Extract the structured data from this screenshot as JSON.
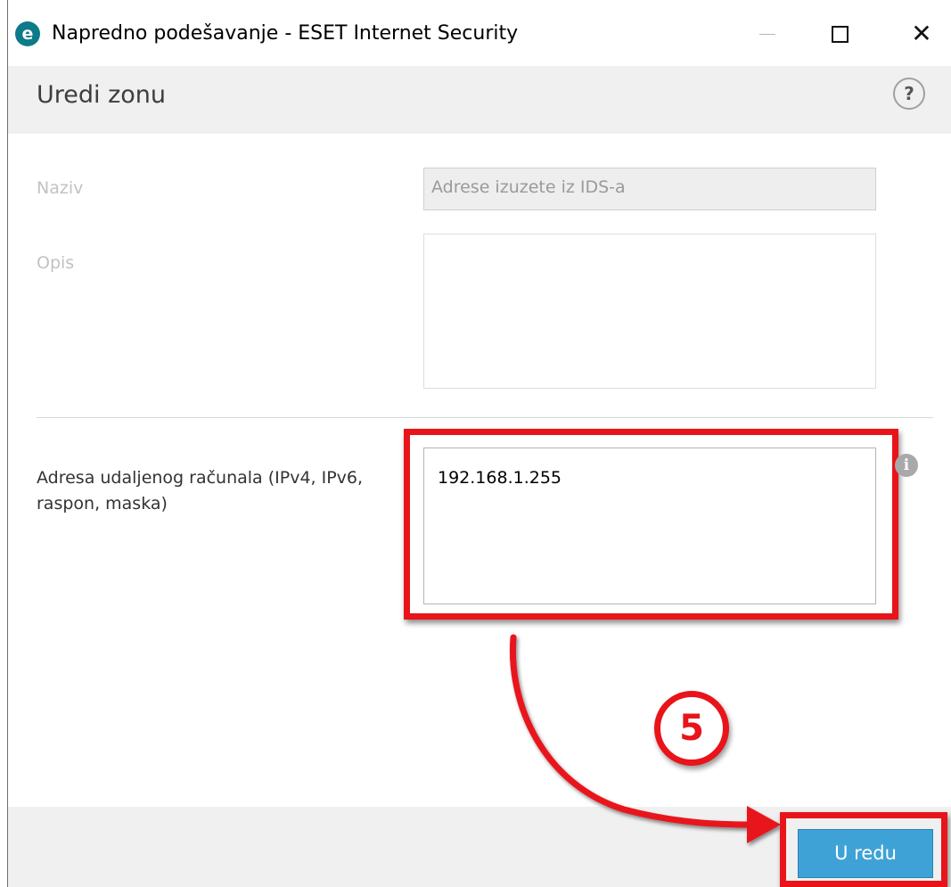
{
  "window": {
    "title": "Napredno podešavanje - ESET Internet Security",
    "app_icon_letter": "e"
  },
  "header": {
    "title": "Uredi zonu",
    "help_glyph": "?"
  },
  "form": {
    "name_label": "Naziv",
    "name_value": "Adrese izuzete iz IDS-a",
    "description_label": "Opis",
    "description_value": "",
    "address_label": "Adresa udaljenog računala (IPv4, IPv6, raspon, maska)",
    "address_value": "192.168.1.255",
    "info_glyph": "i"
  },
  "footer": {
    "ok_label": "U redu"
  },
  "annotation": {
    "step_number": "5",
    "accent_color": "#e8141a"
  },
  "colors": {
    "button_blue": "#3ea2d6",
    "header_gray": "#f0f0f0"
  }
}
